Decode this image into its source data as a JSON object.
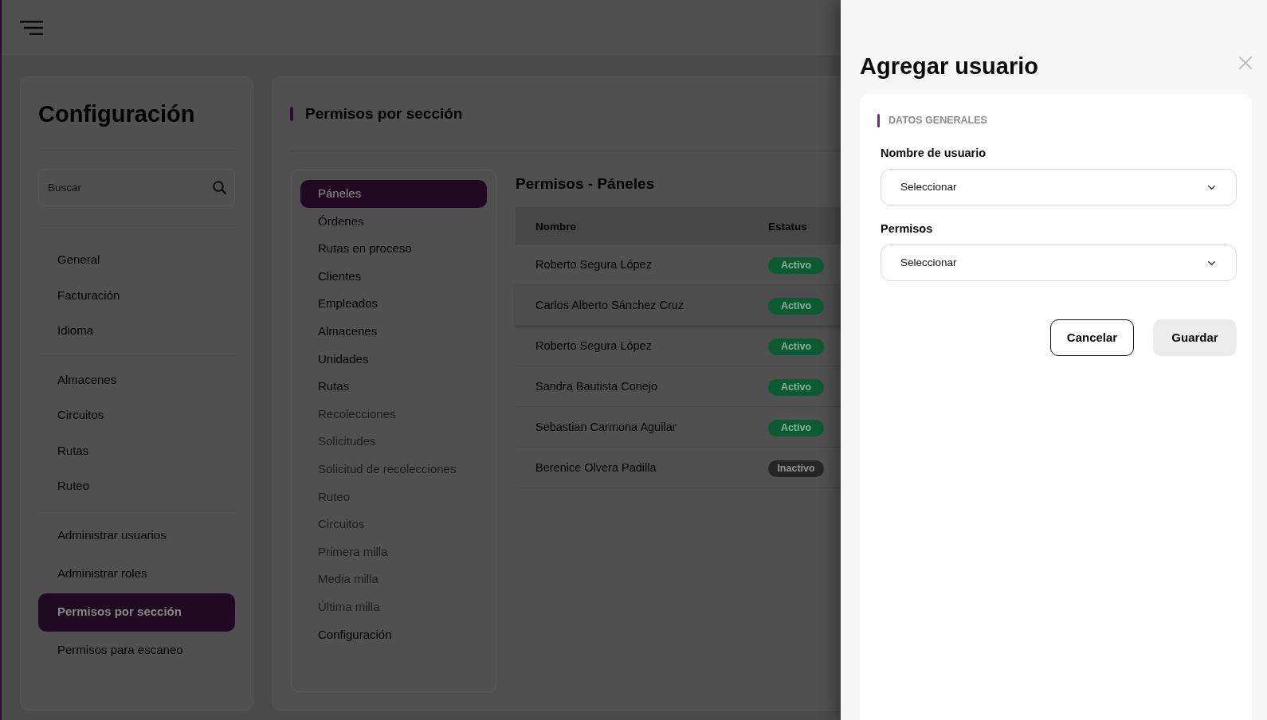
{
  "sidebar": {
    "title": "Configuración",
    "search": {
      "placeholder": "Buscar"
    },
    "groups": [
      {
        "items": [
          {
            "label": "General",
            "selected": false
          },
          {
            "label": "Facturación",
            "selected": false
          },
          {
            "label": "Idioma",
            "selected": false
          }
        ]
      },
      {
        "items": [
          {
            "label": "Almacenes",
            "selected": false
          },
          {
            "label": "Circuitos",
            "selected": false
          },
          {
            "label": "Rutas",
            "selected": false
          },
          {
            "label": "Ruteo",
            "selected": false
          }
        ]
      },
      {
        "items": [
          {
            "label": "Administrar usuarios",
            "selected": false
          },
          {
            "label": "Administrar roles",
            "selected": false
          },
          {
            "label": "Permisos por sección",
            "selected": true
          },
          {
            "label": "Permisos para escaneo",
            "selected": false
          }
        ]
      }
    ]
  },
  "section": {
    "title": "Permisos por sección",
    "modules": [
      {
        "label": "Páneles",
        "selected": true,
        "disabled": false
      },
      {
        "label": "Órdenes",
        "selected": false,
        "disabled": false
      },
      {
        "label": "Rutas en proceso",
        "selected": false,
        "disabled": false
      },
      {
        "label": "Clientes",
        "selected": false,
        "disabled": false
      },
      {
        "label": "Empleados",
        "selected": false,
        "disabled": false
      },
      {
        "label": "Almacenes",
        "selected": false,
        "disabled": false
      },
      {
        "label": "Unidades",
        "selected": false,
        "disabled": false
      },
      {
        "label": "Rutas",
        "selected": false,
        "disabled": false
      },
      {
        "label": "Recolecciones",
        "selected": false,
        "disabled": true
      },
      {
        "label": "Solicitudes",
        "selected": false,
        "disabled": true
      },
      {
        "label": "Solicitud de recolecciones",
        "selected": false,
        "disabled": true
      },
      {
        "label": "Ruteo",
        "selected": false,
        "disabled": true
      },
      {
        "label": "Circuitos",
        "selected": false,
        "disabled": true
      },
      {
        "label": "Primera milla",
        "selected": false,
        "disabled": true
      },
      {
        "label": "Media milla",
        "selected": false,
        "disabled": true
      },
      {
        "label": "Última milla",
        "selected": false,
        "disabled": true
      },
      {
        "label": "Configuración",
        "selected": false,
        "disabled": false
      }
    ],
    "table": {
      "title": "Permisos - Páneles",
      "columns": [
        "Nombre",
        "Estatus"
      ],
      "rows": [
        {
          "name": "Roberto Segura López",
          "status": "Activo",
          "active": true,
          "highlighted": false
        },
        {
          "name": "Carlos Alberto Sánchez Cruz",
          "status": "Activo",
          "active": true,
          "highlighted": true
        },
        {
          "name": "Roberto Segura López",
          "status": "Activo",
          "active": true,
          "highlighted": false
        },
        {
          "name": "Sandra Bautista Conejo",
          "status": "Activo",
          "active": true,
          "highlighted": false
        },
        {
          "name": "Sebastian Carmona Aguilar",
          "status": "Activo",
          "active": true,
          "highlighted": false
        },
        {
          "name": "Berenice Olvera Padilla",
          "status": "Inactivo",
          "active": false,
          "highlighted": false
        }
      ]
    }
  },
  "drawer": {
    "title": "Agregar usuario",
    "section_title": "DATOS GENERALES",
    "fields": [
      {
        "label": "Nombre de usuario",
        "placeholder": "Seleccionar"
      },
      {
        "label": "Permisos",
        "placeholder": "Seleccionar"
      }
    ],
    "buttons": [
      {
        "label": "Cancelar",
        "kind": "secondary"
      },
      {
        "label": "Guardar",
        "kind": "primary"
      }
    ]
  }
}
